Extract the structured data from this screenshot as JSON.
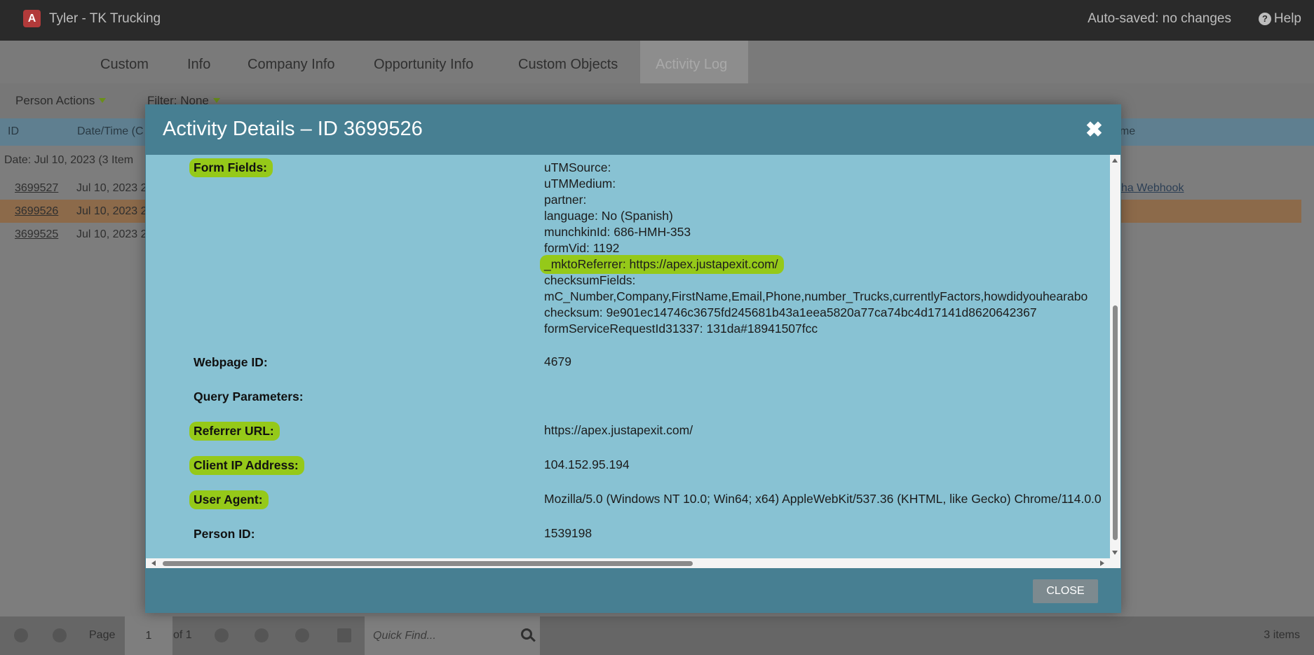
{
  "app": {
    "logo_glyph": "A",
    "title": "Tyler - TK Trucking",
    "autosave": "Auto-saved: no changes",
    "help": "Help"
  },
  "tabs": [
    {
      "label": "Custom"
    },
    {
      "label": "Info"
    },
    {
      "label": "Company Info"
    },
    {
      "label": "Opportunity Info"
    },
    {
      "label": "Custom Objects"
    },
    {
      "label": "Activity Log",
      "active": true
    }
  ],
  "actions": {
    "person_actions": "Person Actions",
    "filter": "Filter: None"
  },
  "grid": {
    "headers": {
      "id": "ID",
      "datetime": "Date/Time (C",
      "name": "ame"
    },
    "group": "Date: Jul 10, 2023 (3 Item",
    "rows": [
      {
        "id": "3699527",
        "datetime": "Jul 10, 2023 2",
        "name": "pha Webhook"
      },
      {
        "id": "3699526",
        "datetime": "Jul 10, 2023 2",
        "name": ""
      },
      {
        "id": "3699525",
        "datetime": "Jul 10, 2023 2",
        "name": ""
      }
    ]
  },
  "pager": {
    "page_label": "Page",
    "page_number": "1",
    "of_label": "of 1",
    "quick_find_placeholder": "Quick Find...",
    "item_count": "3 items"
  },
  "modal": {
    "title": "Activity Details – ID 3699526",
    "close_x": "✖",
    "close_button": "CLOSE",
    "highlight_color": "#95c919",
    "form_fields_label": "Form Fields:",
    "form_fields": [
      {
        "text": "uTMSource:"
      },
      {
        "text": "uTMMedium:"
      },
      {
        "text": "partner:"
      },
      {
        "text": "language: No (Spanish)"
      },
      {
        "text": "munchkinId: 686-HMH-353"
      },
      {
        "text": "formVid: 1192"
      },
      {
        "text": "_mktoReferrer: https://apex.justapexit.com/",
        "highlighted": true
      },
      {
        "text": "checksumFields:"
      },
      {
        "text": "mC_Number,Company,FirstName,Email,Phone,number_Trucks,currentlyFactors,howdidyouhearabo"
      },
      {
        "text": "checksum: 9e901ec14746c3675fd245681b43a1eea5820a77ca74bc4d17141d8620642367"
      },
      {
        "text": "formServiceRequestId31337: 131da#18941507fcc"
      }
    ],
    "details": [
      {
        "label": "Webpage ID:",
        "value": "4679",
        "highlighted": false
      },
      {
        "label": "Query Parameters:",
        "value": "",
        "highlighted": false
      },
      {
        "label": "Referrer URL:",
        "value": "https://apex.justapexit.com/",
        "highlighted": true
      },
      {
        "label": "Client IP Address:",
        "value": "104.152.95.194",
        "highlighted": true
      },
      {
        "label": "User Agent:",
        "value": "Mozilla/5.0 (Windows NT 10.0; Win64; x64) AppleWebKit/537.36 (KHTML, like Gecko) Chrome/114.0.0",
        "highlighted": true
      },
      {
        "label": "Person ID:",
        "value": "1539198",
        "highlighted": false
      }
    ]
  }
}
